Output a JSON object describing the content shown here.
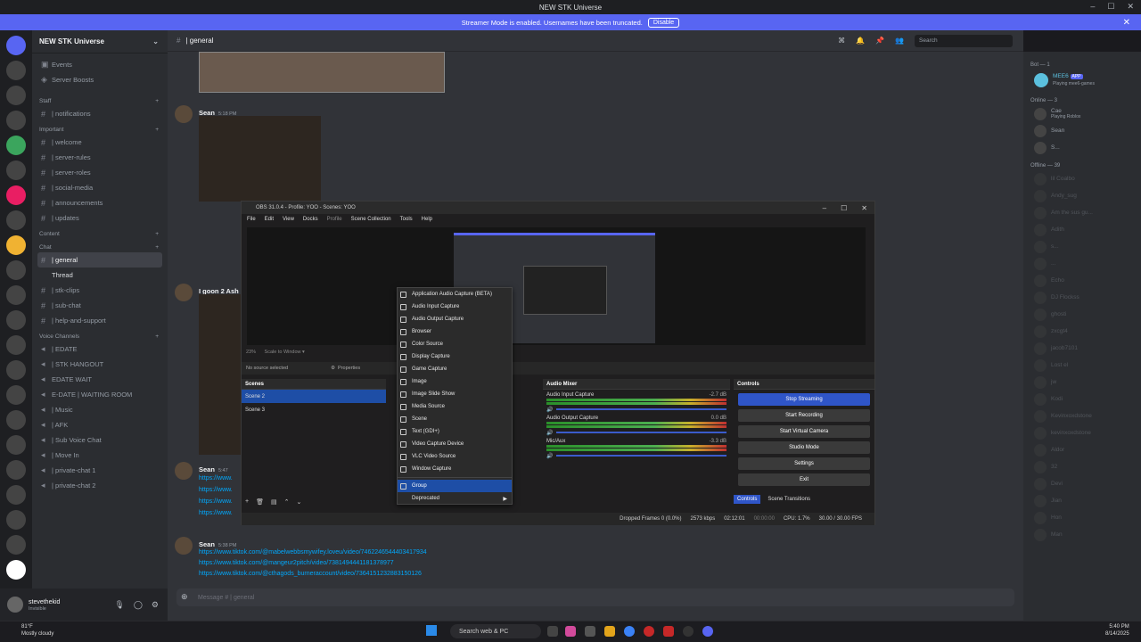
{
  "window": {
    "title": "NEW STK Universe"
  },
  "streamer_bar": {
    "text": "Streamer Mode is enabled. Usernames have been truncated.",
    "button": "Disable"
  },
  "server": {
    "name": "NEW STK Universe"
  },
  "sidebar": {
    "top_items": [
      "Events",
      "Server Boosts"
    ],
    "categories": [
      {
        "name": "Staff",
        "channels": [
          "| notifications"
        ]
      },
      {
        "name": "Important",
        "channels": [
          "| welcome",
          "| server-rules",
          "| server-roles",
          "| social-media",
          "| announcements",
          "| updates"
        ]
      },
      {
        "name": "Content",
        "channels": []
      },
      {
        "name": "Chat",
        "channels": [
          "| general",
          "Thread",
          "| stk-clips",
          "| sub-chat",
          "| help-and-support"
        ]
      },
      {
        "name": "Voice Channels",
        "channels": [
          "| EDATE",
          "| STK HANGOUT",
          "EDATE WAIT",
          "E-DATE | WAITING ROOM",
          "| Music",
          "| AFK",
          "| Sub Voice Chat",
          "| Move In",
          "| private-chat 1",
          "| private-chat 2"
        ]
      }
    ]
  },
  "user_panel": {
    "name": "stevethekid",
    "status": "Invisible"
  },
  "channel_header": {
    "name": "| general",
    "search_placeholder": "Search"
  },
  "messages": [
    {
      "author": "Sean",
      "time": "5:18 PM"
    },
    {
      "author": "I goon 2 Ash"
    },
    {
      "author": "Sean",
      "time": "5:47",
      "links": [
        "https://www.",
        "https://www.",
        "https://www.",
        "https://www."
      ]
    },
    {
      "author": "Sean",
      "time": "5:38 PM",
      "links": [
        "https://www.tiktok.com/@mabelwebbsmywifey.loveu/video/7462246544403417934",
        "https://www.tiktok.com/@mangeur2pitch/video/7381494441181378977",
        "https://www.tiktok.com/@cthagods_burneraccount/video/7364151232883150126"
      ]
    }
  ],
  "composer": {
    "placeholder": "Message # | general"
  },
  "members": {
    "bot_header": "Bot — 1",
    "bot": {
      "name": "MEE6",
      "tag": "APP",
      "activity": "Playing mee6-games"
    },
    "online_header": "Online — 3",
    "online": [
      {
        "name": "Cae",
        "activity": "Playing Roblox"
      },
      {
        "name": "Sean"
      },
      {
        "name": "S..."
      }
    ],
    "offline_header": "Offline — 39",
    "offline": [
      "lil Coalbo",
      "Andy_sug",
      "Am the sus gu...",
      "Adith",
      "s...",
      "...",
      "Echo",
      "DJ Flockss",
      "ghosti",
      "zxcgt4",
      "jacob7101",
      "Lost el",
      "jw",
      "Kodi",
      "Kevinxoxdstone",
      "kevinxoxdstone",
      "Aldor",
      "32",
      "Devi",
      "Jian",
      "Hon",
      "Man"
    ]
  },
  "obs": {
    "title": "OBS 31.0.4 - Profile: YOO - Scenes: YOO",
    "menu": [
      "File",
      "Edit",
      "View",
      "Docks",
      "Profile",
      "Scene Collection",
      "Tools",
      "Help"
    ],
    "strip": {
      "zoom": "23%",
      "scale": "Scale to Window",
      "no_source": "No source selected",
      "properties": "Properties"
    },
    "scenes_title": "Scenes",
    "scenes": [
      "Scene 2",
      "Scene 3"
    ],
    "mixer_title": "Audio Mixer",
    "mixer": [
      {
        "name": "Audio Input Capture",
        "db": "-2.7 dB"
      },
      {
        "name": "Audio Output Capture",
        "db": "0.0 dB"
      },
      {
        "name": "Mic/Aux",
        "db": "-3.3 dB"
      }
    ],
    "controls_title": "Controls",
    "controls": [
      "Stop Streaming",
      "Start Recording",
      "Start Virtual Camera",
      "Studio Mode",
      "Settings",
      "Exit"
    ],
    "tabs": [
      "Controls",
      "Scene Transitions"
    ],
    "status": {
      "dropped": "Dropped Frames 0 (0.0%)",
      "kbps": "2573 kbps",
      "live": "02:12:01",
      "rec": "00:00:00",
      "cpu": "CPU: 1.7%",
      "fps": "30.00 / 30.00 FPS"
    },
    "context_menu": [
      "Application Audio Capture (BETA)",
      "Audio Input Capture",
      "Audio Output Capture",
      "Browser",
      "Color Source",
      "Display Capture",
      "Game Capture",
      "Image",
      "Image Slide Show",
      "Media Source",
      "Scene",
      "Text (GDI+)",
      "Video Capture Device",
      "VLC Video Source",
      "Window Capture",
      "Group",
      "Deprecated"
    ]
  },
  "taskbar": {
    "weather": "81°F",
    "weather_desc": "Mostly cloudy",
    "search": "Search web & PC",
    "time": "5:40 PM",
    "date": "8/14/2025"
  }
}
